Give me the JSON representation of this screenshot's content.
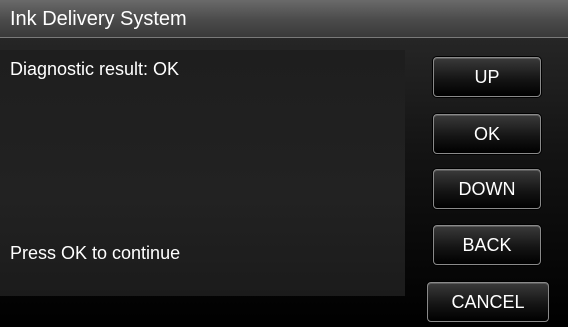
{
  "header": {
    "title": "Ink Delivery System"
  },
  "content": {
    "result_text": "Diagnostic result: OK",
    "instruction_text": "Press OK to continue"
  },
  "buttons": {
    "up": "UP",
    "ok": "OK",
    "down": "DOWN",
    "back": "BACK",
    "cancel": "CANCEL"
  },
  "colors": {
    "background": "#000000",
    "title_bar": "#4a4a4a",
    "text": "#ffffff",
    "button_border": "#8a8a8a"
  }
}
